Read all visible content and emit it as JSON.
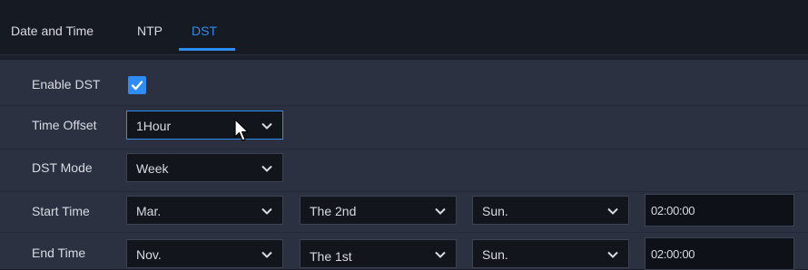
{
  "tabs": {
    "section_title": "Date and Time",
    "ntp": "NTP",
    "dst": "DST"
  },
  "rows": {
    "enable_dst": {
      "label": "Enable DST",
      "checked": true
    },
    "time_offset": {
      "label": "Time Offset",
      "value": "1Hour"
    },
    "dst_mode": {
      "label": "DST Mode",
      "value": "Week"
    },
    "start_time": {
      "label": "Start Time",
      "month": "Mar.",
      "week": "The 2nd",
      "day": "Sun.",
      "time": "02:00:00"
    },
    "end_time": {
      "label": "End Time",
      "month": "Nov.",
      "week": "The 1st",
      "day": "Sun.",
      "time": "02:00:00"
    }
  },
  "colors": {
    "accent": "#2f8cf2",
    "panel": "#2b3140",
    "header": "#161a23"
  },
  "icons": {
    "dropdown": "chevron-down-icon",
    "checkbox": "check-icon",
    "pointer": "mouse-pointer-icon"
  }
}
